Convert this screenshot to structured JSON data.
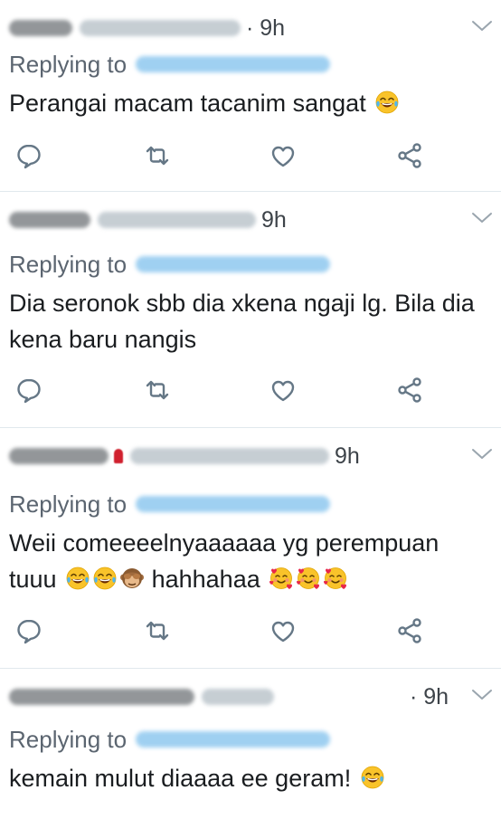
{
  "tweets": [
    {
      "time": "· 9h",
      "replying_label": "Replying to",
      "text": "Perangai macam tacanim sangat"
    },
    {
      "time": "9h",
      "replying_label": "Replying to",
      "text": "Dia seronok sbb dia xkena ngaji lg. Bila dia kena baru nangis"
    },
    {
      "time": "9h",
      "replying_label": "Replying to",
      "text_a": "Weii comeeeelnyaaaaaa yg perempuan tuuu",
      "text_b": "hahhahaa"
    },
    {
      "time": "· 9h",
      "replying_label": "Replying to",
      "text": "kemain mulut diaaaa ee geram!"
    }
  ],
  "icons": {
    "reply": "reply-icon",
    "retweet": "retweet-icon",
    "like": "heart-icon",
    "share": "share-icon",
    "more": "chevron-down-icon",
    "laugh": "face-with-tears-of-joy-emoji",
    "monkey": "see-no-evil-monkey-emoji",
    "love": "smiling-face-with-hearts-emoji"
  },
  "colors": {
    "icon": "#657786",
    "mention": "#1da1f2",
    "divider": "#e1e8ed"
  }
}
